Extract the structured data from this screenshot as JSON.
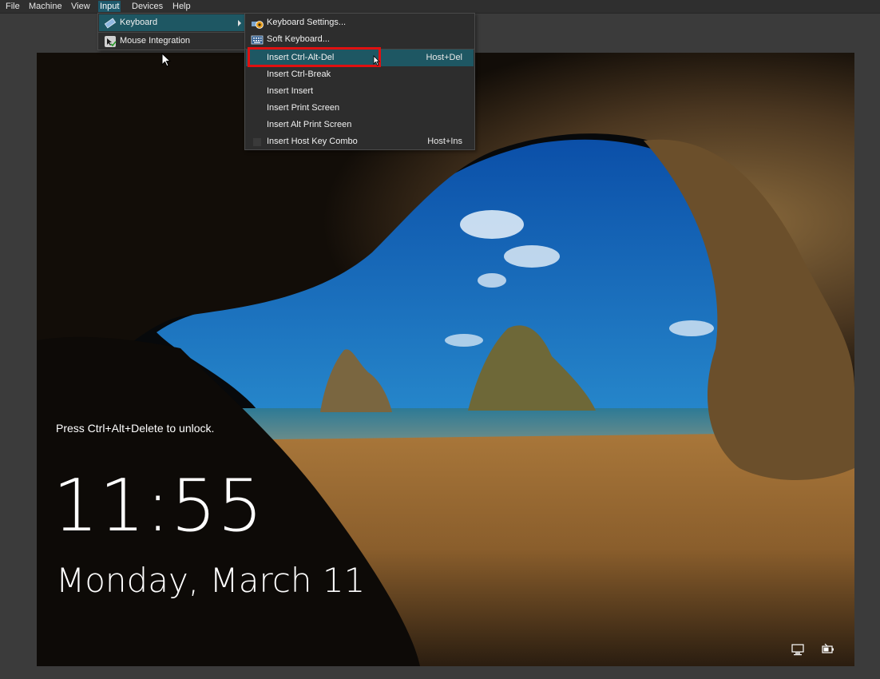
{
  "menubar": {
    "items": [
      {
        "label": "File"
      },
      {
        "label": "Machine"
      },
      {
        "label": "View"
      },
      {
        "label": "Input"
      },
      {
        "label": "Devices"
      },
      {
        "label": "Help"
      }
    ]
  },
  "input_menu": {
    "items": [
      {
        "label": "Keyboard",
        "icon": "keyboard-icon"
      },
      {
        "label": "Mouse Integration",
        "icon": "mouse-integration-icon"
      }
    ]
  },
  "keyboard_menu": {
    "items": [
      {
        "label": "Keyboard Settings...",
        "icon": "keyboard-settings-icon"
      },
      {
        "label": "Soft Keyboard...",
        "icon": "soft-keyboard-icon"
      },
      {
        "label": "Insert Ctrl-Alt-Del",
        "shortcut": "Host+Del"
      },
      {
        "label": "Insert Ctrl-Break"
      },
      {
        "label": "Insert Insert"
      },
      {
        "label": "Insert Print Screen"
      },
      {
        "label": "Insert Alt Print Screen"
      },
      {
        "label": "Insert Host Key Combo",
        "shortcut": "Host+Ins"
      }
    ]
  },
  "lockscreen": {
    "message": "Press Ctrl+Alt+Delete to unlock.",
    "time": "11:55",
    "date": "Monday, March 11",
    "icons": [
      "network-icon",
      "power-icon"
    ]
  },
  "colors": {
    "menu_highlight": "#1e5763",
    "annotation_box": "#e01010",
    "menubar_active": "#1e5a6c"
  }
}
